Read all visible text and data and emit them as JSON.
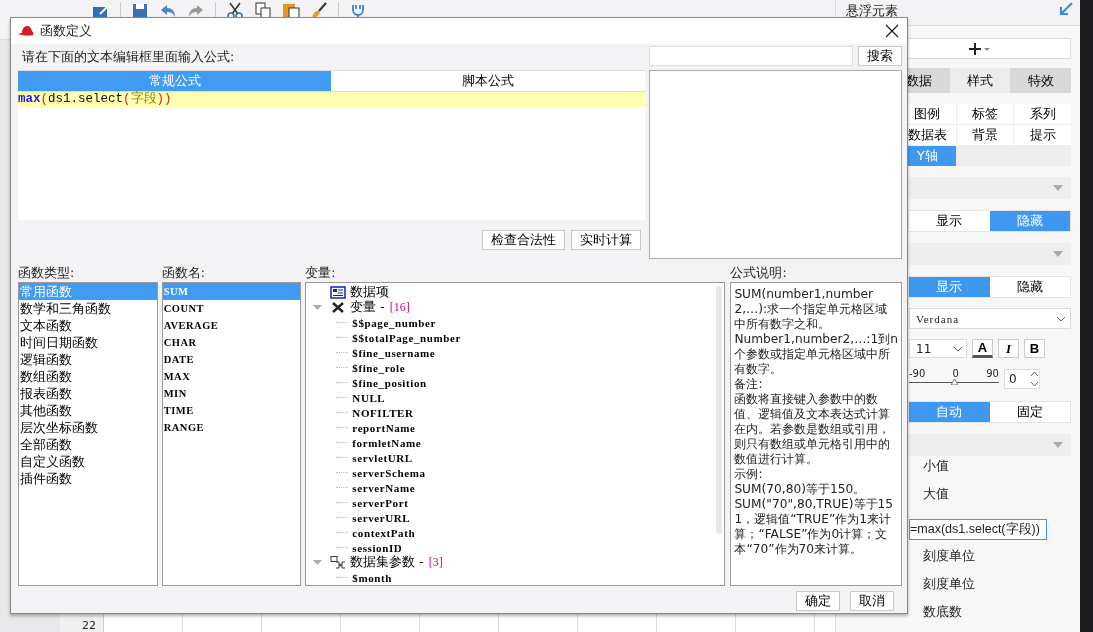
{
  "sheet": {
    "row_number": "22"
  },
  "side_panel": {
    "title": "悬浮元素",
    "tabs": [
      {
        "label": "数据",
        "selected": false
      },
      {
        "label": "样式",
        "selected": true
      },
      {
        "label": "特效",
        "selected": false
      }
    ],
    "sub_tabs": [
      {
        "label": "图例",
        "selected": false
      },
      {
        "label": "标签",
        "selected": false
      },
      {
        "label": "系列",
        "selected": false
      },
      {
        "label": "数据表",
        "selected": false
      },
      {
        "label": "背景",
        "selected": false
      },
      {
        "label": "提示",
        "selected": false
      },
      {
        "label": "Y轴",
        "selected": true
      }
    ],
    "label_toggle": [
      {
        "label": "显示",
        "selected": false
      },
      {
        "label": "隐藏",
        "selected": true
      }
    ],
    "axis_toggle": [
      {
        "label": "显示",
        "selected": true
      },
      {
        "label": "隐藏",
        "selected": false
      }
    ],
    "font": "Verdana",
    "font_size": "11",
    "style_buttons": [
      {
        "text": "A",
        "kind": "color"
      },
      {
        "text": "I",
        "kind": "italic"
      },
      {
        "text": "B",
        "kind": "bold"
      }
    ],
    "rotation": {
      "ticks": [
        "-90",
        "0",
        "90"
      ],
      "level": 0.5,
      "value": "0"
    },
    "mode_toggle": [
      {
        "label": "自动",
        "selected": true
      },
      {
        "label": "固定",
        "selected": false
      }
    ],
    "options": [
      {
        "kind": "label",
        "text": "小值"
      },
      {
        "kind": "label",
        "text": "大值"
      },
      {
        "kind": "field",
        "text": "=max(ds1.select(字段))"
      },
      {
        "kind": "label",
        "text": "刻度单位"
      },
      {
        "kind": "label",
        "text": "刻度单位"
      },
      {
        "kind": "label",
        "text": "数底数"
      }
    ]
  },
  "dialog": {
    "title": "函数定义",
    "prompt": "请在下面的文本编辑框里面输入公式:",
    "editor_tabs": [
      {
        "label": "常规公式",
        "selected": true
      },
      {
        "label": "脚本公式",
        "selected": false
      }
    ],
    "formula": [
      {
        "text": "max",
        "kind": "function"
      },
      {
        "text": "(",
        "kind": "paren"
      },
      {
        "text": "ds1.select",
        "kind": "plain"
      },
      {
        "text": "(",
        "kind": "paren"
      },
      {
        "text": "字段",
        "kind": "field"
      },
      {
        "text": "))",
        "kind": "paren"
      }
    ],
    "check_buttons": [
      "检查合法性",
      "实时计算"
    ],
    "search_button": "搜索",
    "function_types": {
      "label": "函数类型:",
      "items": [
        {
          "label": "常用函数",
          "selected": true
        },
        {
          "label": "数学和三角函数",
          "selected": false
        },
        {
          "label": "文本函数",
          "selected": false
        },
        {
          "label": "时间日期函数",
          "selected": false
        },
        {
          "label": "逻辑函数",
          "selected": false
        },
        {
          "label": "数组函数",
          "selected": false
        },
        {
          "label": "报表函数",
          "selected": false
        },
        {
          "label": "其他函数",
          "selected": false
        },
        {
          "label": "层次坐标函数",
          "selected": false
        },
        {
          "label": "全部函数",
          "selected": false
        },
        {
          "label": "自定义函数",
          "selected": false
        },
        {
          "label": "插件函数",
          "selected": false
        }
      ]
    },
    "function_names": {
      "label": "函数名:",
      "items": [
        {
          "label": "SUM",
          "selected": true
        },
        {
          "label": "COUNT",
          "selected": false
        },
        {
          "label": "AVERAGE",
          "selected": false
        },
        {
          "label": "CHAR",
          "selected": false
        },
        {
          "label": "DATE",
          "selected": false
        },
        {
          "label": "MAX",
          "selected": false
        },
        {
          "label": "MIN",
          "selected": false
        },
        {
          "label": "TIME",
          "selected": false
        },
        {
          "label": "RANGE",
          "selected": false
        }
      ]
    },
    "variables": {
      "label": "变量:",
      "tree": [
        {
          "label": "数据项",
          "kind": "data-item"
        },
        {
          "label": "变量 -",
          "count": "[16]",
          "kind": "variables",
          "expanded": true,
          "children": [
            {
              "label": "$$page_number"
            },
            {
              "label": "$$totalPage_number"
            },
            {
              "label": "$fine_username"
            },
            {
              "label": "$fine_role"
            },
            {
              "label": "$fine_position"
            },
            {
              "label": "NULL"
            },
            {
              "label": "NOFILTER"
            },
            {
              "label": "reportName"
            },
            {
              "label": "formletName"
            },
            {
              "label": "servletURL"
            },
            {
              "label": "serverSchema"
            },
            {
              "label": "serverName"
            },
            {
              "label": "serverPort"
            },
            {
              "label": "serverURL"
            },
            {
              "label": "contextPath"
            },
            {
              "label": "sessionID"
            }
          ]
        },
        {
          "label": "数据集参数 -",
          "count": "[3]",
          "kind": "parameters",
          "expanded": true,
          "children": [
            {
              "label": "$month"
            }
          ]
        }
      ]
    },
    "description": {
      "label": "公式说明:",
      "paragraphs": [
        "SUM(number1,number2,…):求一个指定单元格区域中所有数字之和。",
        "Number1,number2,…:1到n个参数或指定单元格区域中所有数字。",
        "备注:",
        "函数将直接键入参数中的数值、逻辑值及文本表达式计算在内。若参数是数组或引用，则只有数组或单元格引用中的数值进行计算。",
        "示例:",
        "SUM(70,80)等于150。",
        "SUM(\"70\",80,TRUE)等于151，逻辑值“TRUE”作为1来计算；“FALSE”作为0计算；文本“70”作为70来计算。"
      ]
    },
    "buttons": [
      "确定",
      "取消"
    ]
  }
}
